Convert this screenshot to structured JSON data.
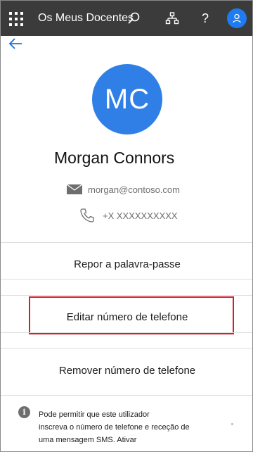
{
  "header": {
    "app_title": "Os Meus Docentes",
    "icons": [
      "waffle-icon",
      "search-icon",
      "org-chart-icon",
      "help-icon",
      "user-avatar-icon"
    ],
    "help_glyph": "?",
    "colors": {
      "bar": "#3b3b3b",
      "avatar": "#1f7bf0"
    }
  },
  "profile": {
    "initials": "MC",
    "name": "Morgan Connors",
    "email": "morgan@contoso.com",
    "phone": "+X XXXXXXXXXX",
    "avatar_color": "#2f7fe6"
  },
  "actions": {
    "reset_password": "Repor a palavra-passe",
    "edit_phone": "Editar número de telefone",
    "remove_phone": "Remover número de telefone",
    "highlight_color": "#d81e2c"
  },
  "info": {
    "icon_glyph": "i",
    "line1": "Pode permitir que este utilizador",
    "line2": "inscreva o número de telefone e receção de",
    "line3": "uma mensagem SMS. Ativar"
  }
}
